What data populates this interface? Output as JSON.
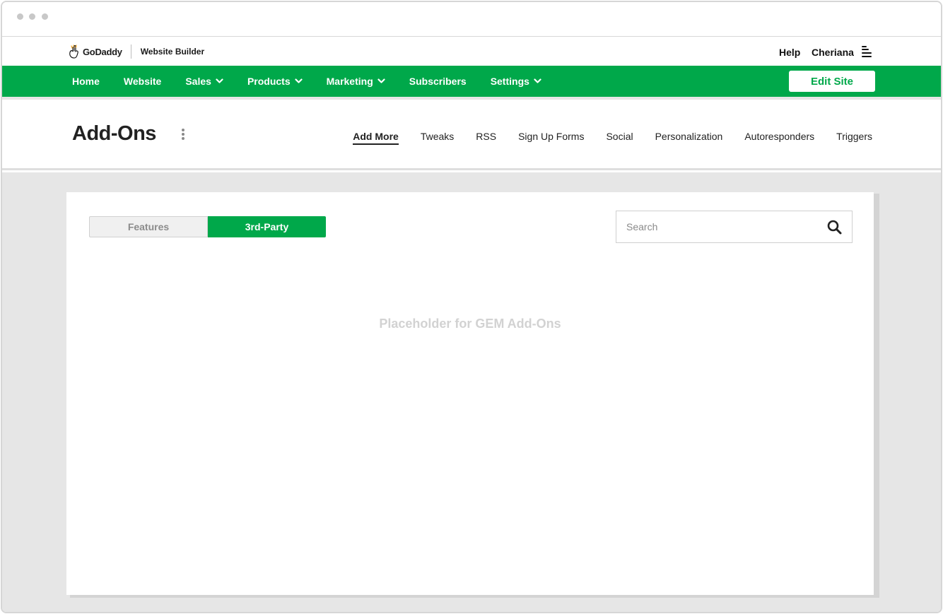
{
  "brand": {
    "logo_text": "GoDaddy",
    "product_name": "Website Builder",
    "accent_color": "#00a84a"
  },
  "topbar": {
    "help_label": "Help",
    "user_name": "Cheriana",
    "menu_icon": "hamburger-menu-icon",
    "notification_color": "#f2c94c"
  },
  "nav": {
    "items": [
      {
        "label": "Home",
        "has_dropdown": false
      },
      {
        "label": "Website",
        "has_dropdown": false
      },
      {
        "label": "Sales",
        "has_dropdown": true
      },
      {
        "label": "Products",
        "has_dropdown": true
      },
      {
        "label": "Marketing",
        "has_dropdown": true
      },
      {
        "label": "Subscribers",
        "has_dropdown": false
      },
      {
        "label": "Settings",
        "has_dropdown": true
      }
    ],
    "edit_site_label": "Edit Site"
  },
  "page": {
    "title": "Add-Ons",
    "subnav": [
      {
        "label": "Add More",
        "active": true
      },
      {
        "label": "Tweaks",
        "active": false
      },
      {
        "label": "RSS",
        "active": false
      },
      {
        "label": "Sign Up Forms",
        "active": false
      },
      {
        "label": "Social",
        "active": false
      },
      {
        "label": "Personalization",
        "active": false
      },
      {
        "label": "Autoresponders",
        "active": false
      },
      {
        "label": "Triggers",
        "active": false
      }
    ]
  },
  "card": {
    "toggle": {
      "features_label": "Features",
      "third_party_label": "3rd-Party",
      "selected": "3rd-Party"
    },
    "search": {
      "placeholder": "Search",
      "value": ""
    },
    "placeholder_text": "Placeholder for GEM Add-Ons"
  }
}
